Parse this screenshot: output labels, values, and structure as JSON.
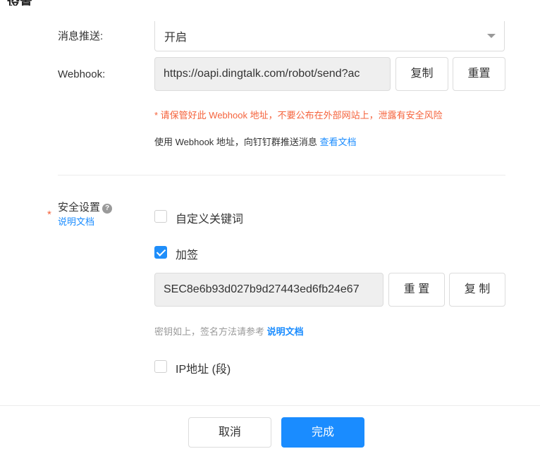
{
  "dialog": {
    "title": "设置"
  },
  "push": {
    "label": "消息推送:",
    "value": "开启"
  },
  "webhook": {
    "label": "Webhook:",
    "value": "https://oapi.dingtalk.com/robot/send?ac",
    "copy_label": "复制",
    "reset_label": "重置",
    "warning": "* 请保管好此 Webhook 地址，不要公布在外部网站上，泄露有安全风险",
    "info": "使用 Webhook 地址，向钉钉群推送消息",
    "doc_link": "查看文档"
  },
  "security": {
    "label": "安全设置",
    "required_mark": "*",
    "help_glyph": "?",
    "doc_link": "说明文档",
    "keyword": {
      "label": "自定义关键词",
      "checked": false
    },
    "sign": {
      "label": "加签",
      "checked": true
    },
    "secret": "SEC8e6b93d027b9d27443ed6fb24e67",
    "reset_label": "重 置",
    "copy_label": "复 制",
    "hint": "密钥如上，签名方法请参考",
    "hint_link": "说明文档",
    "ip": {
      "label": "IP地址 (段)",
      "checked": false
    }
  },
  "footer": {
    "cancel_label": "取消",
    "done_label": "完成"
  },
  "colors": {
    "accent": "#1a8cff",
    "warning": "#f5633c",
    "checkbox_checked": "#1f8efa"
  }
}
